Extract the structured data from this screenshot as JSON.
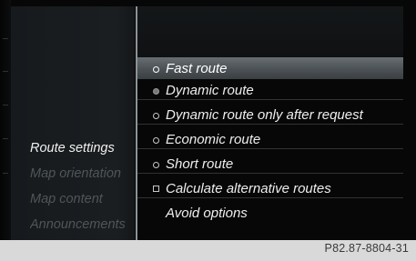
{
  "sidebar": {
    "items": [
      {
        "label": "Route settings",
        "state": "active"
      },
      {
        "label": "Map orientation",
        "state": "inactive"
      },
      {
        "label": "Map content",
        "state": "inactive"
      },
      {
        "label": "Announcements",
        "state": "inactive"
      }
    ]
  },
  "route_menu": {
    "items": [
      {
        "label": "Fast route",
        "control": "radio",
        "checked": false,
        "highlighted": true
      },
      {
        "label": "Dynamic route",
        "control": "radio",
        "checked": true,
        "highlighted": false
      },
      {
        "label": "Dynamic route only after request",
        "control": "radio",
        "checked": false,
        "highlighted": false
      },
      {
        "label": "Economic route",
        "control": "radio",
        "checked": false,
        "highlighted": false
      },
      {
        "label": "Short route",
        "control": "radio",
        "checked": false,
        "highlighted": false
      },
      {
        "label": "Calculate alternative routes",
        "control": "checkbox",
        "checked": false,
        "highlighted": false
      },
      {
        "label": "Avoid options",
        "control": "none",
        "checked": false,
        "highlighted": false
      }
    ]
  },
  "footer": {
    "code": "P82.87-8804-31"
  },
  "colors": {
    "background": "#070707",
    "highlight": "#5c6266",
    "divider": "#8b9398",
    "text": "#eeeeee",
    "dim_text": "#4f5558"
  }
}
